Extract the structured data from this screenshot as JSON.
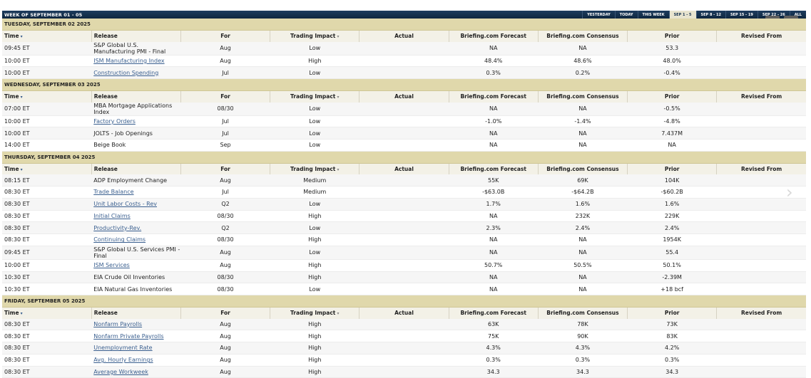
{
  "header": {
    "week_title": "WEEK OF SEPTEMBER 01 - 05",
    "nav": [
      {
        "label": "YESTERDAY",
        "active": false
      },
      {
        "label": "TODAY",
        "active": false
      },
      {
        "label": "THIS WEEK",
        "active": false
      },
      {
        "label": "SEP 1 - 5",
        "active": true
      },
      {
        "label": "SEP 8 - 12",
        "active": false
      },
      {
        "label": "SEP 15 - 19",
        "active": false
      },
      {
        "label": "SEP 22 - 26",
        "active": false
      },
      {
        "label": "ALL",
        "active": false
      }
    ]
  },
  "controls": {
    "play_icon": "▸",
    "close_icon": "✕",
    "next_icon": "›"
  },
  "columns": [
    "Time",
    "Release",
    "For",
    "Trading Impact",
    "Actual",
    "Briefing.com Forecast",
    "Briefing.com Consensus",
    "Prior",
    "Revised From"
  ],
  "days": [
    {
      "label": "TUESDAY, SEPTEMBER 02 2025",
      "rows": [
        {
          "time": "09:45 ET",
          "release": "S&P Global U.S. Manufacturing PMI - Final",
          "link": false,
          "for": "Aug",
          "impact": "Low",
          "actual": "",
          "forecast": "NA",
          "consensus": "NA",
          "prior": "53.3",
          "revised": ""
        },
        {
          "time": "10:00 ET",
          "release": "ISM Manufacturing Index",
          "link": true,
          "for": "Aug",
          "impact": "High",
          "actual": "",
          "forecast": "48.4%",
          "consensus": "48.6%",
          "prior": "48.0%",
          "revised": ""
        },
        {
          "time": "10:00 ET",
          "release": "Construction Spending",
          "link": true,
          "for": "Jul",
          "impact": "Low",
          "actual": "",
          "forecast": "0.3%",
          "consensus": "0.2%",
          "prior": "-0.4%",
          "revised": ""
        }
      ]
    },
    {
      "label": "WEDNESDAY, SEPTEMBER 03 2025",
      "rows": [
        {
          "time": "07:00 ET",
          "release": "MBA Mortgage Applications Index",
          "link": false,
          "for": "08/30",
          "impact": "Low",
          "actual": "",
          "forecast": "NA",
          "consensus": "NA",
          "prior": "-0.5%",
          "revised": ""
        },
        {
          "time": "10:00 ET",
          "release": "Factory Orders",
          "link": true,
          "for": "Jul",
          "impact": "Low",
          "actual": "",
          "forecast": "-1.0%",
          "consensus": "-1.4%",
          "prior": "-4.8%",
          "revised": ""
        },
        {
          "time": "10:00 ET",
          "release": "JOLTS - Job Openings",
          "link": false,
          "for": "Jul",
          "impact": "Low",
          "actual": "",
          "forecast": "NA",
          "consensus": "NA",
          "prior": "7.437M",
          "revised": ""
        },
        {
          "time": "14:00 ET",
          "release": "Beige Book",
          "link": false,
          "for": "Sep",
          "impact": "Low",
          "actual": "",
          "forecast": "NA",
          "consensus": "NA",
          "prior": "NA",
          "revised": ""
        }
      ]
    },
    {
      "label": "THURSDAY, SEPTEMBER 04 2025",
      "rows": [
        {
          "time": "08:15 ET",
          "release": "ADP Employment Change",
          "link": false,
          "for": "Aug",
          "impact": "Medium",
          "actual": "",
          "forecast": "55K",
          "consensus": "69K",
          "prior": "104K",
          "revised": ""
        },
        {
          "time": "08:30 ET",
          "release": "Trade Balance",
          "link": true,
          "for": "Jul",
          "impact": "Medium",
          "actual": "",
          "forecast": "-$63.0B",
          "consensus": "-$64.2B",
          "prior": "-$60.2B",
          "revised": ""
        },
        {
          "time": "08:30 ET",
          "release": "Unit Labor Costs - Rev",
          "link": true,
          "for": "Q2",
          "impact": "Low",
          "actual": "",
          "forecast": "1.7%",
          "consensus": "1.6%",
          "prior": "1.6%",
          "revised": ""
        },
        {
          "time": "08:30 ET",
          "release": "Initial Claims",
          "link": true,
          "for": "08/30",
          "impact": "High",
          "actual": "",
          "forecast": "NA",
          "consensus": "232K",
          "prior": "229K",
          "revised": ""
        },
        {
          "time": "08:30 ET",
          "release": "Productivity-Rev.",
          "link": true,
          "for": "Q2",
          "impact": "Low",
          "actual": "",
          "forecast": "2.3%",
          "consensus": "2.4%",
          "prior": "2.4%",
          "revised": ""
        },
        {
          "time": "08:30 ET",
          "release": "Continuing Claims",
          "link": true,
          "for": "08/30",
          "impact": "High",
          "actual": "",
          "forecast": "NA",
          "consensus": "NA",
          "prior": "1954K",
          "revised": ""
        },
        {
          "time": "09:45 ET",
          "release": "S&P Global U.S. Services PMI - Final",
          "link": false,
          "for": "Aug",
          "impact": "Low",
          "actual": "",
          "forecast": "NA",
          "consensus": "NA",
          "prior": "55.4",
          "revised": ""
        },
        {
          "time": "10:00 ET",
          "release": "ISM Services",
          "link": true,
          "for": "Aug",
          "impact": "High",
          "actual": "",
          "forecast": "50.7%",
          "consensus": "50.5%",
          "prior": "50.1%",
          "revised": ""
        },
        {
          "time": "10:30 ET",
          "release": "EIA Crude Oil Inventories",
          "link": false,
          "for": "08/30",
          "impact": "High",
          "actual": "",
          "forecast": "NA",
          "consensus": "NA",
          "prior": "-2.39M",
          "revised": ""
        },
        {
          "time": "10:30 ET",
          "release": "EIA Natural Gas Inventories",
          "link": false,
          "for": "08/30",
          "impact": "Low",
          "actual": "",
          "forecast": "NA",
          "consensus": "NA",
          "prior": "+18 bcf",
          "revised": ""
        }
      ]
    },
    {
      "label": "FRIDAY, SEPTEMBER 05 2025",
      "rows": [
        {
          "time": "08:30 ET",
          "release": "Nonfarm Payrolls",
          "link": true,
          "for": "Aug",
          "impact": "High",
          "actual": "",
          "forecast": "63K",
          "consensus": "78K",
          "prior": "73K",
          "revised": ""
        },
        {
          "time": "08:30 ET",
          "release": "Nonfarm Private Payrolls",
          "link": true,
          "for": "Aug",
          "impact": "High",
          "actual": "",
          "forecast": "75K",
          "consensus": "90K",
          "prior": "83K",
          "revised": ""
        },
        {
          "time": "08:30 ET",
          "release": "Unemployment Rate",
          "link": true,
          "for": "Aug",
          "impact": "High",
          "actual": "",
          "forecast": "4.3%",
          "consensus": "4.3%",
          "prior": "4.2%",
          "revised": ""
        },
        {
          "time": "08:30 ET",
          "release": "Avg. Hourly Earnings",
          "link": true,
          "for": "Aug",
          "impact": "High",
          "actual": "",
          "forecast": "0.3%",
          "consensus": "0.3%",
          "prior": "0.3%",
          "revised": ""
        },
        {
          "time": "08:30 ET",
          "release": "Average Workweek",
          "link": true,
          "for": "Aug",
          "impact": "High",
          "actual": "",
          "forecast": "34.3",
          "consensus": "34.3",
          "prior": "34.3",
          "revised": ""
        }
      ]
    }
  ]
}
